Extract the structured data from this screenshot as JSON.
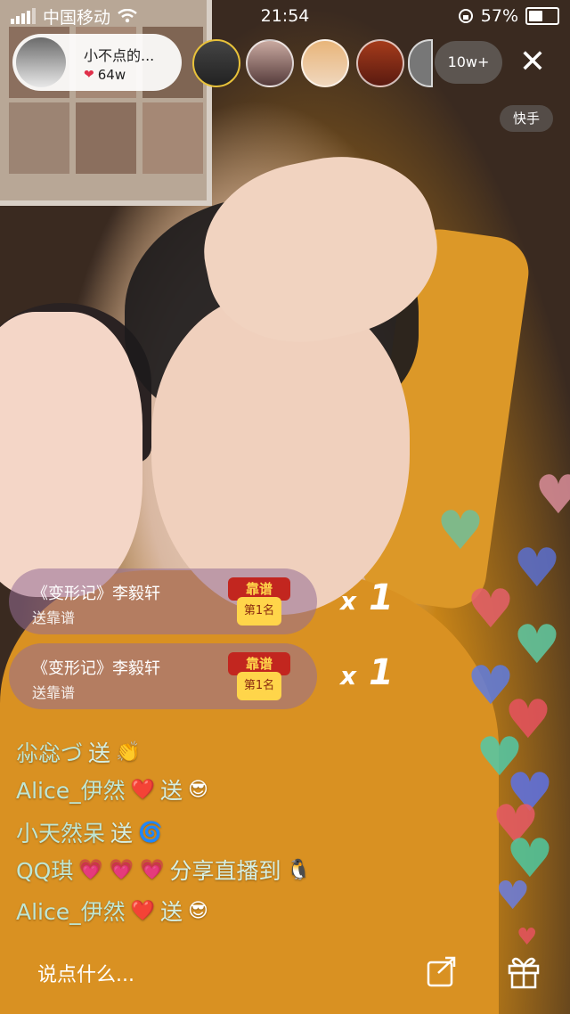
{
  "status_bar": {
    "carrier": "中国移动",
    "time": "21:54",
    "battery": "57%",
    "battery_level": 0.57
  },
  "host": {
    "name": "小不点的...",
    "likes": "64w"
  },
  "viewer_count": "10w+",
  "platform_label": "快手",
  "gifts": [
    {
      "title": "《变形记》李毅轩",
      "subtitle": "送靠谱",
      "badge_top": "靠谱",
      "badge_bottom": "第1名",
      "multiplier_x": "x",
      "multiplier_n": "1"
    },
    {
      "title": "《变形记》李毅轩",
      "subtitle": "送靠谱",
      "badge_top": "靠谱",
      "badge_bottom": "第1名",
      "multiplier_x": "x",
      "multiplier_n": "1"
    }
  ],
  "chat": [
    {
      "user": "尛惢づ",
      "verb": "送",
      "emoji": "👏"
    },
    {
      "user": "Alice_伊然",
      "mid": "❤️",
      "verb": "送",
      "emoji": "😎"
    },
    {
      "user": "小天然呆",
      "verb": "送",
      "emoji": "🌀"
    },
    {
      "user": "QQ琪",
      "mid": "💗 💗 💗",
      "verb": "分享直播到",
      "emoji": "🐧"
    },
    {
      "user": "Alice_伊然",
      "mid": "❤️",
      "verb": "送",
      "emoji": "😎"
    }
  ],
  "input_placeholder": "说点什么...",
  "colors": {
    "gift_pill": "#96709a",
    "chat_user": "#bfe6d4",
    "heart_like": "#e0304a"
  },
  "icons": [
    "signal-icon",
    "wifi-icon",
    "lock-rotation-icon",
    "battery-icon",
    "heart-icon",
    "close-icon",
    "share-icon",
    "gift-icon"
  ]
}
